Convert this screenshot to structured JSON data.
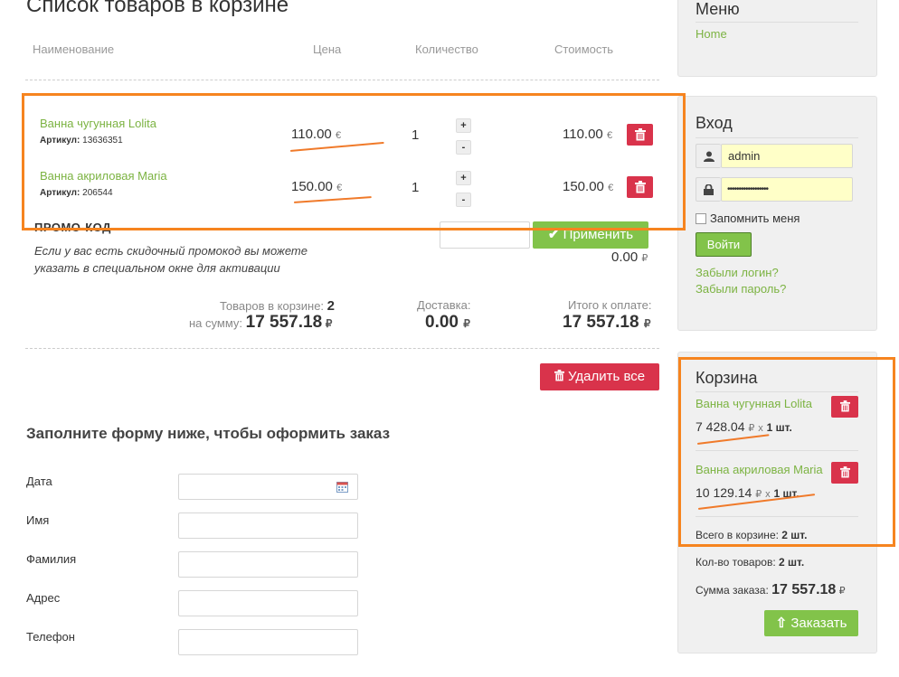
{
  "page": {
    "title": "Список товаров в корзине",
    "columns": [
      "Наименование",
      "Цена",
      "Количество",
      "Стоимость"
    ]
  },
  "cart_items": [
    {
      "name": "Ванна чугунная Lolita",
      "sku_label": "Артикул:",
      "sku": "13636351",
      "price": "110.00",
      "currency": "€",
      "qty": "1",
      "total": "110.00"
    },
    {
      "name": "Ванна акриловая Maria",
      "sku_label": "Артикул:",
      "sku": "206544",
      "price": "150.00",
      "currency": "€",
      "qty": "1",
      "total": "150.00"
    }
  ],
  "promo": {
    "label": "ПРОМО-КОД",
    "hint": "Если у вас есть скидочный промокод вы можете указать в специальном окне для активации",
    "apply_label": "Применить",
    "discount": "0.00"
  },
  "summary": {
    "items_label": "Товаров в корзине:",
    "items_count": "2",
    "sum_label": "на сумму:",
    "sum_value": "17 557.18",
    "delivery_label": "Доставка:",
    "delivery_value": "0.00",
    "total_label": "Итого к оплате:",
    "total_value": "17 557.18",
    "rub": "₽"
  },
  "delete_all_label": "Удалить все",
  "order_form": {
    "heading": "Заполните форму ниже, чтобы оформить заказ",
    "fields": [
      "Дата",
      "Имя",
      "Фамилия",
      "Адрес",
      "Телефон"
    ]
  },
  "sidebar": {
    "menu": {
      "title": "Меню",
      "home": "Home"
    },
    "login": {
      "title": "Вход",
      "username": "admin",
      "password_mask": "••••••••••••••••••",
      "remember_label": "Запомнить меня",
      "submit_label": "Войти",
      "forgot_login": "Забыли логин?",
      "forgot_password": "Забыли пароль?"
    },
    "cart": {
      "title": "Корзина",
      "items": [
        {
          "name": "Ванна чугунная Lolita",
          "price": "7 428.04",
          "qty": "1 шт."
        },
        {
          "name": "Ванна акриловая Maria",
          "price": "10 129.14",
          "qty": "1 шт."
        }
      ],
      "times": "x",
      "rub": "₽",
      "total_in_cart_label": "Всего в корзине:",
      "total_in_cart_value": "2 шт.",
      "count_label": "Кол-во товаров:",
      "count_value": "2 шт.",
      "sum_label": "Сумма заказа:",
      "sum_value": "17 557.18",
      "order_label": "Заказать"
    }
  },
  "colors": {
    "accent_green": "#7cb342",
    "button_red": "#d9334b",
    "annotation_orange": "#f6841f"
  }
}
